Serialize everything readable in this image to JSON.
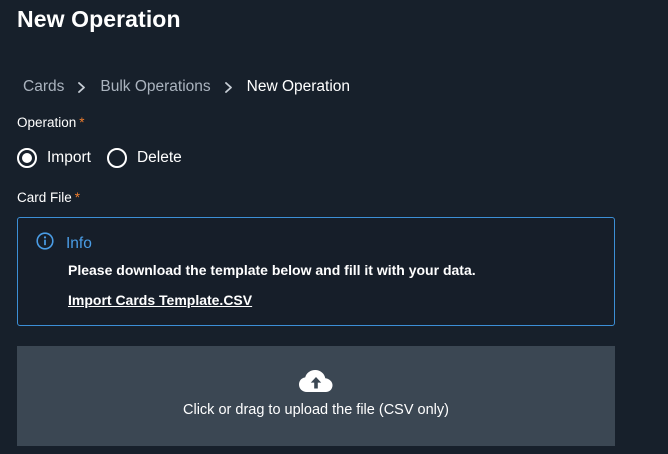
{
  "page": {
    "title": "New Operation"
  },
  "breadcrumb": {
    "items": [
      "Cards",
      "Bulk Operations",
      "New Operation"
    ]
  },
  "operation": {
    "label": "Operation",
    "required_mark": "*",
    "options": [
      {
        "label": "Import",
        "checked": true
      },
      {
        "label": "Delete",
        "checked": false
      }
    ]
  },
  "card_file": {
    "label": "Card File",
    "required_mark": "*"
  },
  "info": {
    "icon": "info-circle-icon",
    "title": "Info",
    "message": "Please download the template below and fill it with your data.",
    "template_link": "Import Cards Template.CSV"
  },
  "upload": {
    "icon": "cloud-upload-icon",
    "text": "Click or drag to upload the file (CSV only)"
  },
  "colors": {
    "background": "#17202b",
    "accent": "#4a9de6",
    "required": "#ef7d2d",
    "upload_zone": "#3b4753"
  }
}
